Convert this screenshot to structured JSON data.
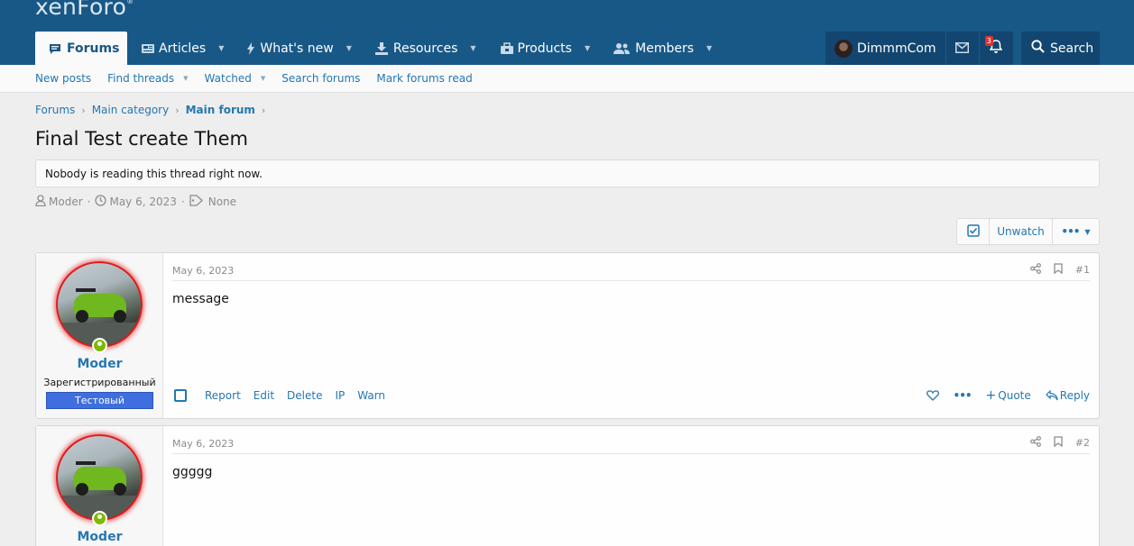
{
  "logo": {
    "text": "xenForo",
    "mark": "®"
  },
  "nav": {
    "tabs": [
      {
        "label": "Forums",
        "icon": "forums-icon",
        "active": true
      },
      {
        "label": "Articles",
        "icon": "articles-icon"
      },
      {
        "label": "What's new",
        "icon": "bolt-icon"
      },
      {
        "label": "Resources",
        "icon": "download-icon"
      },
      {
        "label": "Products",
        "icon": "products-icon"
      },
      {
        "label": "Members",
        "icon": "users-icon"
      }
    ],
    "user": {
      "name": "DimmmCom"
    },
    "alerts_count": "3",
    "search_label": "Search"
  },
  "subnav": {
    "new_posts": "New posts",
    "find_threads": "Find threads",
    "watched": "Watched",
    "search_forums": "Search forums",
    "mark_read": "Mark forums read"
  },
  "breadcrumb": [
    "Forums",
    "Main category",
    "Main forum"
  ],
  "thread": {
    "title": "Final Test create Them",
    "notice": "Nobody is reading this thread right now.",
    "author": "Moder",
    "date": "May 6, 2023",
    "tags": "None",
    "unwatch_label": "Unwatch"
  },
  "posts": [
    {
      "author": "Moder",
      "user_title": "Зарегистрированный",
      "banner": "Тестовый",
      "date": "May 6, 2023",
      "number": "#1",
      "message": "message",
      "actions": {
        "report": "Report",
        "edit": "Edit",
        "delete": "Delete",
        "ip": "IP",
        "warn": "Warn",
        "quote": "Quote",
        "reply": "Reply"
      }
    },
    {
      "author": "Moder",
      "date": "May 6, 2023",
      "number": "#2",
      "message": "ggggg"
    }
  ],
  "colors": {
    "header": "#185886",
    "link": "#2577b1",
    "banner": "#3f6ede",
    "online": "#7fb900"
  }
}
